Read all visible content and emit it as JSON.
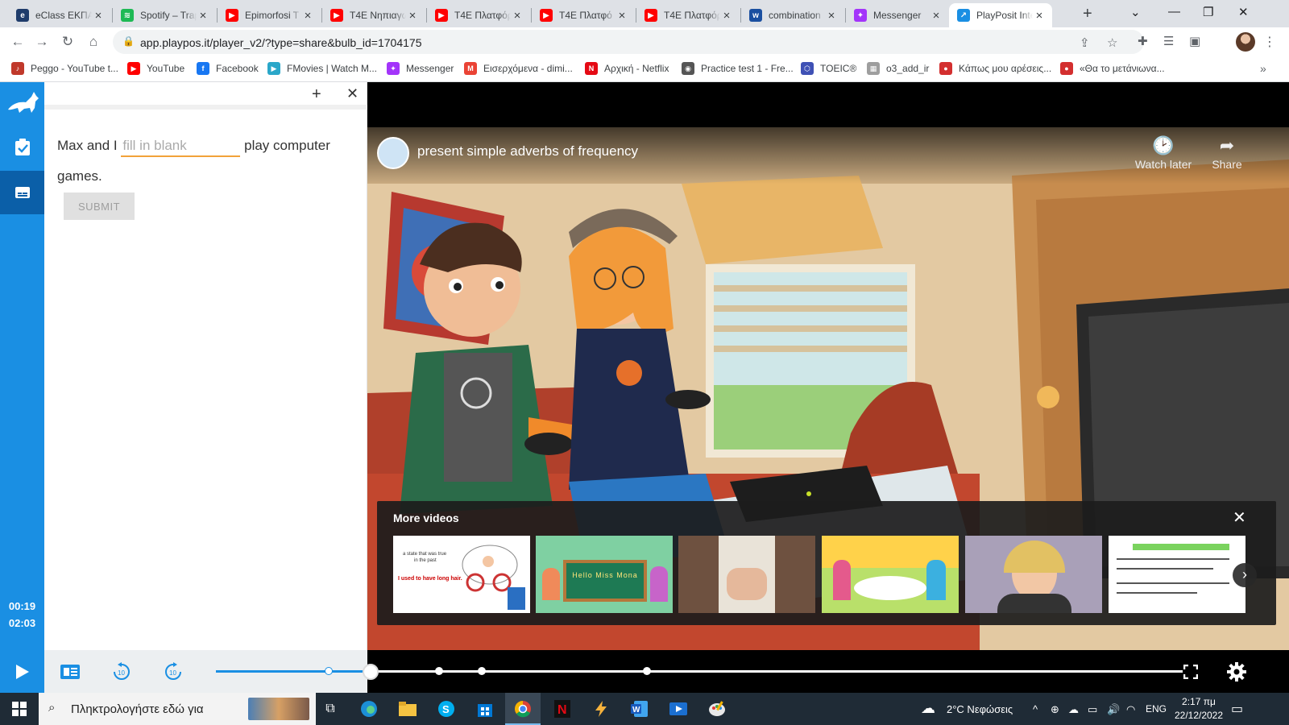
{
  "browser": {
    "tabs": [
      {
        "title": "eClass ΕΚΠΑ",
        "icon": "eclass-icon",
        "color": "#1f3c6b",
        "glyph": "e"
      },
      {
        "title": "Spotify – Trap",
        "icon": "spotify-icon",
        "color": "#1db954",
        "glyph": "≋"
      },
      {
        "title": "Epimorfosi T",
        "icon": "youtube-icon",
        "color": "#ff0000",
        "glyph": "▶"
      },
      {
        "title": "T4E Νηπιαγω",
        "icon": "youtube-icon",
        "color": "#ff0000",
        "glyph": "▶"
      },
      {
        "title": "T4E Πλατφόρ",
        "icon": "youtube-icon",
        "color": "#ff0000",
        "glyph": "▶"
      },
      {
        "title": "T4E Πλατφό",
        "icon": "youtube-icon",
        "color": "#ff0000",
        "glyph": "▶"
      },
      {
        "title": "T4E Πλατφόρ",
        "icon": "youtube-icon",
        "color": "#ff0000",
        "glyph": "▶"
      },
      {
        "title": "combination",
        "icon": "wordreference-icon",
        "color": "#1a4fa0",
        "glyph": "w"
      },
      {
        "title": "Messenger",
        "icon": "messenger-icon",
        "color": "#a334fa",
        "glyph": "✦"
      },
      {
        "title": "PlayPosit Inte",
        "icon": "playposit-icon",
        "color": "#1a8fe3",
        "glyph": "↗"
      }
    ],
    "url": "app.playpos.it/player_v2/?type=share&bulb_id=1704175",
    "bookmarks": [
      {
        "label": "Peggo - YouTube t...",
        "color": "#c0392b",
        "glyph": "♪"
      },
      {
        "label": "YouTube",
        "color": "#ff0000",
        "glyph": "▶"
      },
      {
        "label": "Facebook",
        "color": "#1877f2",
        "glyph": "f"
      },
      {
        "label": "FMovies | Watch M...",
        "color": "#2aa7c9",
        "glyph": "▶"
      },
      {
        "label": "Messenger",
        "color": "#a334fa",
        "glyph": "✦"
      },
      {
        "label": "Εισερχόμενα - dimi...",
        "color": "#ea4335",
        "glyph": "M"
      },
      {
        "label": "Αρχική - Netflix",
        "color": "#e50914",
        "glyph": "N"
      },
      {
        "label": "Practice test 1 - Fre...",
        "color": "#555555",
        "glyph": "◉"
      },
      {
        "label": "TOEIC®",
        "color": "#3f51b5",
        "glyph": "⬡"
      },
      {
        "label": "o3_add_ir",
        "color": "#9e9e9e",
        "glyph": "▦"
      },
      {
        "label": "Κάπως μου αρέσεις...",
        "color": "#d32f2f",
        "glyph": "●"
      },
      {
        "label": "«Θα το μετάνιωνα...",
        "color": "#d32f2f",
        "glyph": "●"
      }
    ]
  },
  "player": {
    "question": {
      "before": "Max and I",
      "placeholder": "fill in blank",
      "after": "play computer games."
    },
    "submit_label": "SUBMIT",
    "elapsed": "00:19",
    "duration": "02:03",
    "video": {
      "title": "present simple adverbs of frequency",
      "watch_later": "Watch later",
      "share": "Share",
      "more_videos_title": "More videos",
      "thumbnail_texts": {
        "t1_line1": "a state that was true",
        "t1_line2": "in the past",
        "t1_line3": "I used to have long hair.",
        "t2": "Hello Miss Mona"
      }
    },
    "progress_fraction": 0.155
  },
  "taskbar": {
    "search_placeholder": "Πληκτρολογήστε εδώ για",
    "weather": "2°C  Νεφώσεις",
    "lang": "ENG",
    "time": "2:17 πμ",
    "date": "22/12/2022"
  }
}
